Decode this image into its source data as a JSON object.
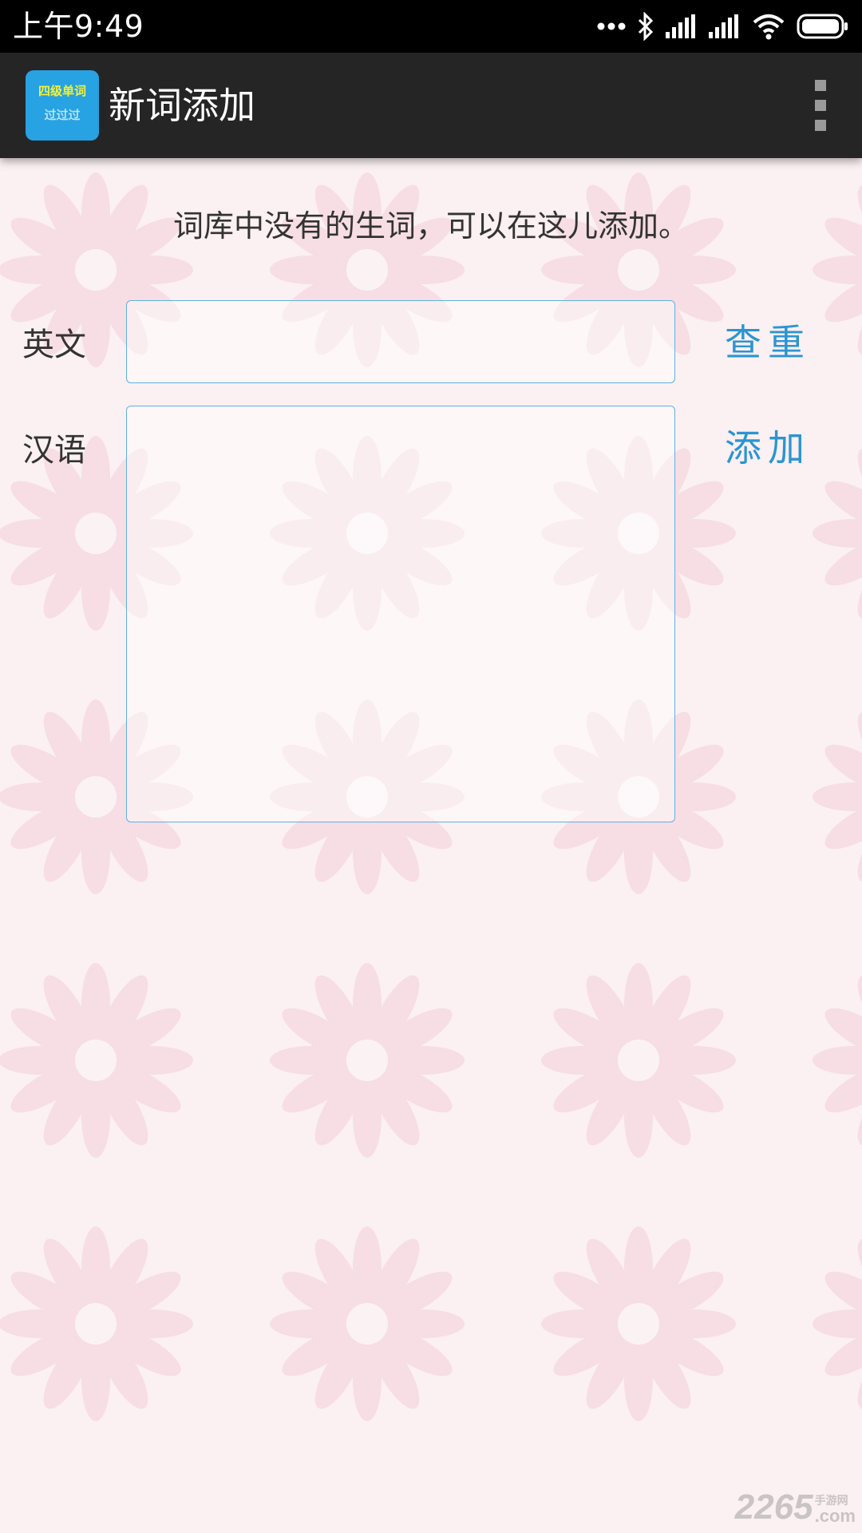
{
  "status_bar": {
    "time": "上午9:49",
    "icons": [
      "more-dots-icon",
      "bluetooth-icon",
      "signal-icon",
      "signal-icon",
      "wifi-icon",
      "battery-icon"
    ]
  },
  "app_bar": {
    "logo": {
      "line1": "四级单词",
      "line2": "过过过"
    },
    "title": "新词添加",
    "menu_icon": "overflow-menu-icon"
  },
  "form": {
    "hint": "词库中没有的生词，可以在这儿添加。",
    "english_label": "英文",
    "english_value": "",
    "chinese_label": "汉语",
    "chinese_value": "",
    "check_duplicate_label": "查重",
    "add_label": "添加"
  },
  "watermark": {
    "number": "2265",
    "site_cn": "手游网",
    "site_suffix": ".com"
  },
  "colors": {
    "status_bar": "#000000",
    "app_bar": "#252525",
    "logo_bg": "#27a2e3",
    "accent": "#2b95d2",
    "input_border": "#5fb2e3",
    "background": "#fbf0f2",
    "pattern": "#f2c9d4"
  }
}
